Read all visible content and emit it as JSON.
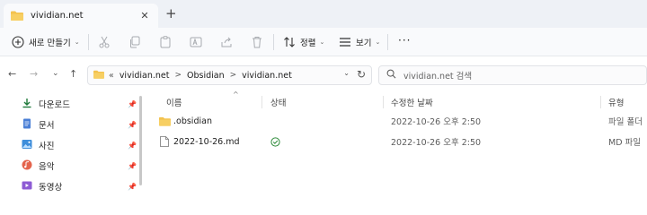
{
  "tab": {
    "title": "vividian.net",
    "close": "✕",
    "new_tab": "+"
  },
  "toolbar": {
    "new": "새로 만들기",
    "sort": "정렬",
    "view": "보기",
    "more": "···"
  },
  "nav": {
    "back": "←",
    "forward": "→",
    "recent": "⌄",
    "up": "↑"
  },
  "address": {
    "prefix": "«",
    "crumbs": [
      "vividian.net",
      "Obsidian",
      "vividian.net"
    ],
    "sep": ">"
  },
  "search": {
    "placeholder": "vividian.net 검색"
  },
  "sidebar": {
    "items": [
      {
        "label": "다운로드",
        "icon": "download-icon"
      },
      {
        "label": "문서",
        "icon": "document-icon"
      },
      {
        "label": "사진",
        "icon": "pictures-icon"
      },
      {
        "label": "음악",
        "icon": "music-icon"
      },
      {
        "label": "동영상",
        "icon": "video-icon"
      }
    ]
  },
  "columns": {
    "name": "이름",
    "status": "상태",
    "modified": "수정한 날짜",
    "type": "유형"
  },
  "files": [
    {
      "name": ".obsidian",
      "icon": "folder-icon",
      "status": "",
      "modified": "2022-10-26 오후 2:50",
      "type": "파일 폴더"
    },
    {
      "name": "2022-10-26.md",
      "icon": "file-icon",
      "status": "synced",
      "modified": "2022-10-26 오후 2:50",
      "type": "MD 파일"
    }
  ],
  "colors": {
    "folder": "#f3c24e",
    "accent": "#0f6cbd",
    "sync": "#2e8b3a"
  }
}
